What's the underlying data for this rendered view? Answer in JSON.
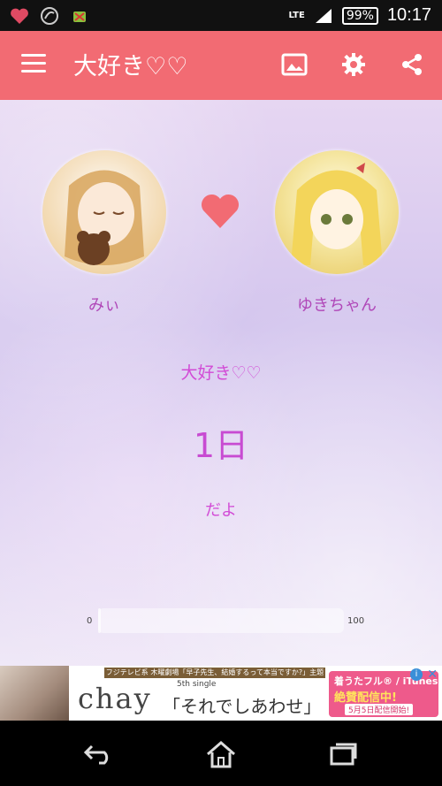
{
  "status_bar": {
    "network": "LTE",
    "battery": "99%",
    "time": "10:17",
    "icons": [
      "heart-notification-icon",
      "app-notification-icon",
      "android-debug-icon"
    ]
  },
  "app_bar": {
    "title": "大好き♡♡",
    "icons": [
      "menu-icon",
      "image-icon",
      "gear-icon",
      "share-icon"
    ],
    "color": "#F26B73"
  },
  "profile": {
    "left_name": "みぃ",
    "right_name": "ゆきちゃん",
    "heart_color": "#F26B73"
  },
  "main": {
    "headline": "大好き♡♡",
    "days": "1日",
    "suffix": "だよ",
    "text_color": "#D24BD6"
  },
  "progress": {
    "min_label": "0",
    "max_label": "100",
    "value_percent": 1
  },
  "ad": {
    "topline": "フジテレビ系 木曜劇場「早子先生、結婚するって本当ですか?」主題歌",
    "brand": "chay",
    "single": "5th single",
    "song": "「それでしあわせ」",
    "right_line1": "着うたフル® / iTunes",
    "right_line2": "絶賛配信中!",
    "right_line3": "5月5日配信開始!"
  },
  "nav_bar": {
    "icons": [
      "back-icon",
      "home-icon",
      "recent-apps-icon"
    ]
  }
}
